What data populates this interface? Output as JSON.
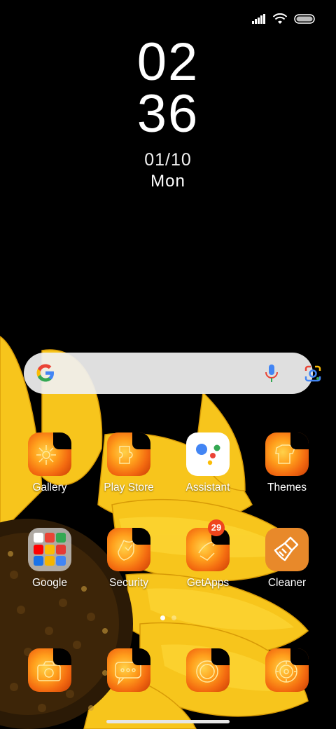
{
  "status_bar": {
    "signal_icon": "signal-bars-icon",
    "wifi_icon": "wifi-icon",
    "battery_icon": "battery-icon"
  },
  "clock": {
    "hours": "02",
    "minutes": "36",
    "date": "01/10",
    "weekday": "Mon"
  },
  "search": {
    "logo_icon": "google-g-icon",
    "mic_icon": "mic-icon",
    "lens_icon": "google-lens-icon"
  },
  "apps_row1": [
    {
      "label": "Gallery",
      "icon": "gallery-icon"
    },
    {
      "label": "Play Store",
      "icon": "play-store-icon"
    },
    {
      "label": "Assistant",
      "icon": "assistant-icon"
    },
    {
      "label": "Themes",
      "icon": "themes-icon"
    }
  ],
  "apps_row2": [
    {
      "label": "Google",
      "icon": "google-folder-icon"
    },
    {
      "label": "Security",
      "icon": "security-icon"
    },
    {
      "label": "GetApps",
      "icon": "getapps-icon",
      "badge": "29"
    },
    {
      "label": "Cleaner",
      "icon": "cleaner-icon"
    }
  ],
  "dock": [
    {
      "icon": "camera-icon"
    },
    {
      "icon": "messages-icon"
    },
    {
      "icon": "browser-icon"
    },
    {
      "icon": "settings-icon"
    }
  ],
  "page_indicator": {
    "pages": 2,
    "active": 1
  },
  "colors": {
    "accent_orange": "#f36a10",
    "badge_red": "#f0451c",
    "cleaner_orange": "#e8892a",
    "petal_yellow": "#f7c81e"
  }
}
